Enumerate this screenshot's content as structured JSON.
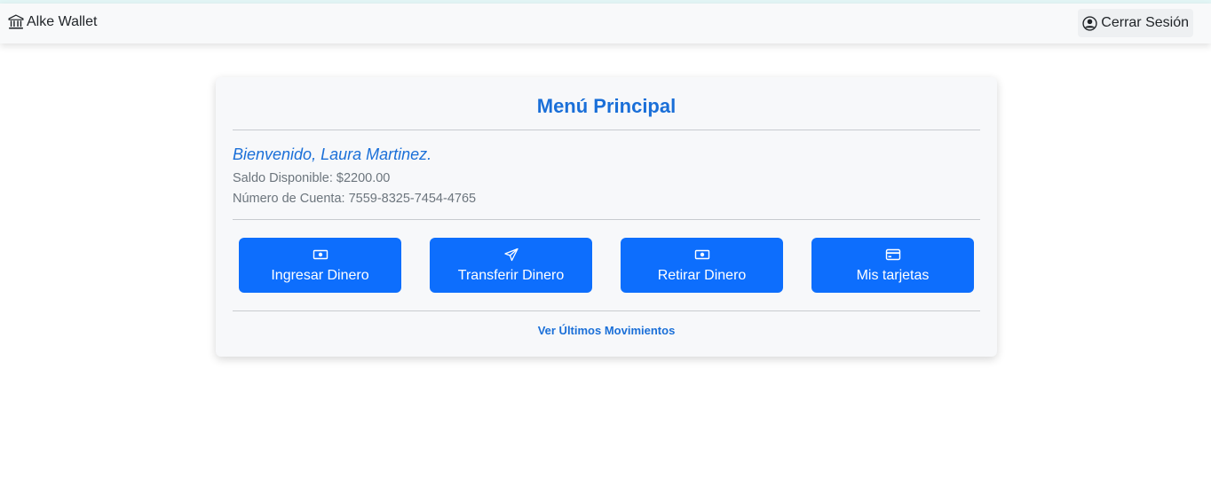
{
  "navbar": {
    "brand": "Alke Wallet",
    "brand_icon": "bank-icon",
    "logout_label": "Cerrar Sesión",
    "logout_icon": "person-circle-icon"
  },
  "card": {
    "title": "Menú Principal",
    "welcome": "Bienvenido, Laura Martinez.",
    "balance": "Saldo Disponible: $2200.00",
    "account": "Número de Cuenta: 7559-8325-7454-4765"
  },
  "actions": [
    {
      "label": "Ingresar Dinero",
      "icon": "cash-icon"
    },
    {
      "label": "Transferir Dinero",
      "icon": "send-icon"
    },
    {
      "label": "Retirar Dinero",
      "icon": "cash-icon"
    },
    {
      "label": "Mis tarjetas",
      "icon": "credit-card-icon"
    }
  ],
  "movements_link": "Ver Últimos Movimientos",
  "colors": {
    "primary": "#0d6efd",
    "heading_blue": "#1a6fd8",
    "navbar_bg": "#f8f9fa",
    "card_bg": "#f7f8fa"
  }
}
